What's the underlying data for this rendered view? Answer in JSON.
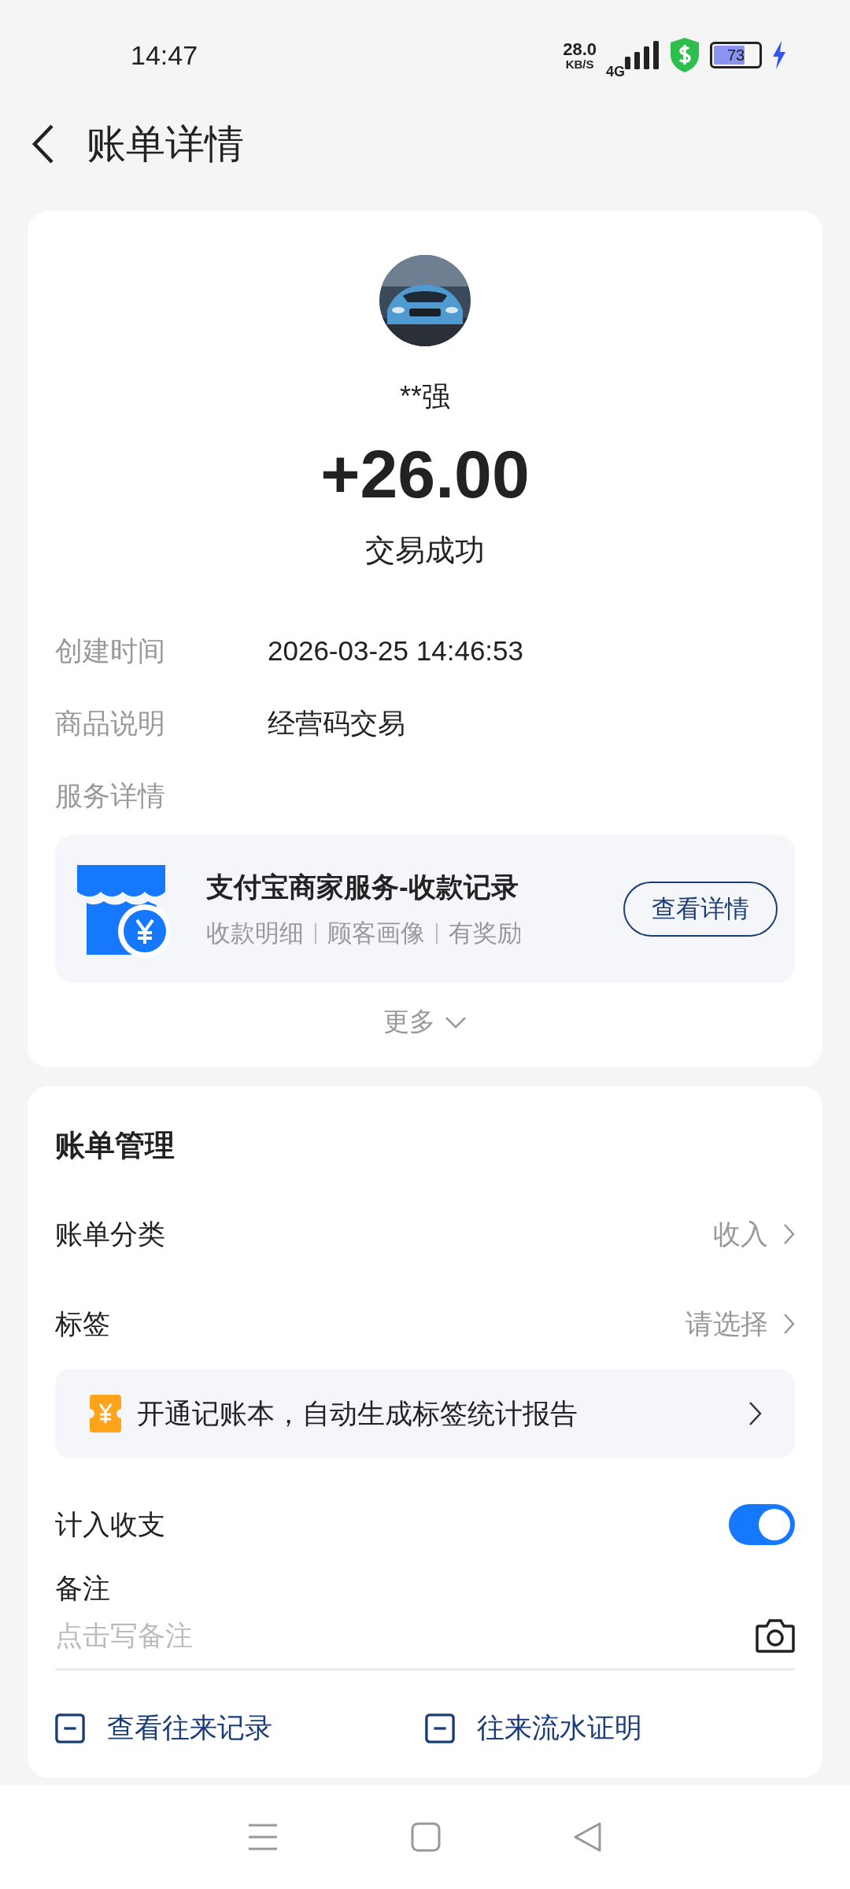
{
  "status_bar": {
    "time": "14:47",
    "speed": "28.0",
    "speed_unit": "KB/S",
    "network": "4G",
    "battery": "73",
    "charging": true
  },
  "header": {
    "title": "账单详情"
  },
  "summary": {
    "name": "**强",
    "amount": "+26.00",
    "status": "交易成功",
    "fields": [
      {
        "label": "创建时间",
        "value": "2026-03-25 14:46:53"
      },
      {
        "label": "商品说明",
        "value": "经营码交易"
      },
      {
        "label": "服务详情"
      }
    ],
    "service": {
      "title": "支付宝商家服务-收款记录",
      "tags": [
        "收款明细",
        "顾客画像",
        "有奖励"
      ],
      "button": "查看详情"
    },
    "more": "更多"
  },
  "management": {
    "title": "账单管理",
    "rows": [
      {
        "kind": "select",
        "label": "账单分类",
        "value": "收入"
      },
      {
        "kind": "select",
        "label": "标签",
        "value": "请选择"
      },
      {
        "kind": "banner",
        "label": "开通记账本，自动生成标签统计报告"
      },
      {
        "kind": "toggle",
        "label": "计入收支",
        "on": true
      }
    ],
    "note": {
      "label": "备注",
      "placeholder": "点击写备注"
    },
    "links": [
      "查看往来记录",
      "往来流水证明"
    ]
  }
}
